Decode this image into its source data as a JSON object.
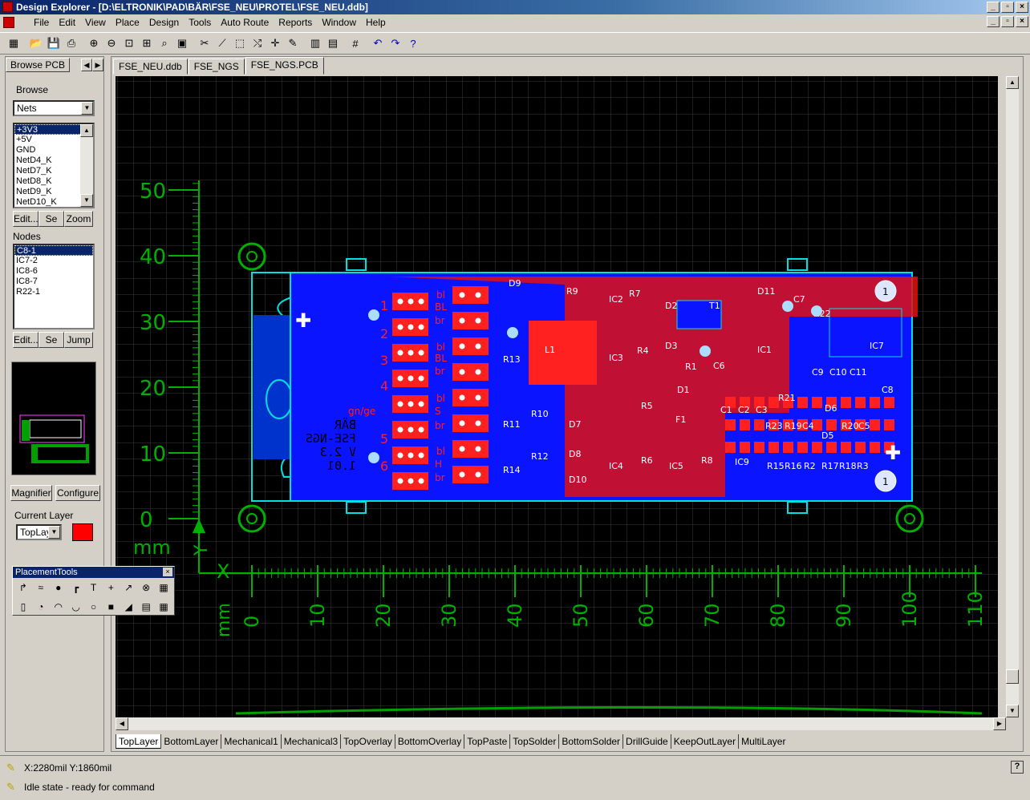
{
  "window": {
    "title": "Design Explorer - [D:\\ELTRONIK\\PAD\\BÄR\\FSE_NEU\\PROTEL\\FSE_NEU.ddb]"
  },
  "menu": [
    "File",
    "Edit",
    "View",
    "Place",
    "Design",
    "Tools",
    "Auto Route",
    "Reports",
    "Window",
    "Help"
  ],
  "toolbar_icons": [
    "design-manager-icon",
    "open-icon",
    "save-icon",
    "print-icon",
    "zoom-in-icon",
    "zoom-out-icon",
    "zoom-fit-icon",
    "zoom-area-icon",
    "zoom-selected-icon",
    "browse-icon",
    "cut-icon",
    "paste-icon",
    "select-icon",
    "deselect-icon",
    "move-icon",
    "cross-probe-icon",
    "library-icon",
    "component-icon",
    "grid-icon",
    "undo-icon",
    "redo-icon",
    "help-icon"
  ],
  "left_panel": {
    "tab": "Browse PCB",
    "browse_label": "Browse",
    "browse_select": "Nets",
    "nets": [
      "+3V3",
      "+5V",
      "GND",
      "NetD4_K",
      "NetD7_K",
      "NetD8_K",
      "NetD9_K",
      "NetD10_K"
    ],
    "net_buttons": [
      "Edit...",
      "Se",
      "Zoom"
    ],
    "nodes_label": "Nodes",
    "nodes": [
      "C8-1",
      "IC7-2",
      "IC8-6",
      "IC8-7",
      "R22-1"
    ],
    "node_buttons": [
      "Edit...",
      "Se",
      "Jump"
    ],
    "magnifier": "Magnifier",
    "configure": "Configure",
    "current_layer_label": "Current Layer",
    "current_layer": "TopLay",
    "current_layer_color": "#ff0000"
  },
  "doc_tabs": [
    "FSE_NEU.ddb",
    "FSE_NGS",
    "FSE_NGS.PCB"
  ],
  "layer_tabs": [
    "TopLayer",
    "BottomLayer",
    "Mechanical1",
    "Mechanical3",
    "TopOverlay",
    "BottomOverlay",
    "TopPaste",
    "TopSolder",
    "BottomSolder",
    "DrillGuide",
    "KeepOutLayer",
    "MultiLayer"
  ],
  "ruler": {
    "y_labels": [
      "50",
      "40",
      "30",
      "20",
      "10",
      "0"
    ],
    "x_labels": [
      "0",
      "10",
      "20",
      "30",
      "40",
      "50",
      "60",
      "70",
      "80",
      "90",
      "100",
      "110"
    ],
    "unit": "mm",
    "x_axis": "X",
    "y_axis": "Y"
  },
  "pcb": {
    "labels": [
      "D9",
      "R9",
      "IC2",
      "R7",
      "D2",
      "T1",
      "D11",
      "C7",
      "R22",
      "IC7",
      "L1",
      "D3",
      "R4",
      "IC1",
      "R13",
      "IC3",
      "R1",
      "C6",
      "C9",
      "C10",
      "C11",
      "C8",
      "D1",
      "R21",
      "R10",
      "R5",
      "F1",
      "C1",
      "C2",
      "C3",
      "D6",
      "R11",
      "D7",
      "R23",
      "R19",
      "C4",
      "R20",
      "C5",
      "D5",
      "R12",
      "D8",
      "IC4",
      "R6",
      "R8",
      "IC9",
      "R15",
      "R16",
      "R2",
      "R17",
      "R18",
      "R3",
      "R14",
      "D10",
      "IC5"
    ],
    "wire_labels": [
      "bl",
      "BL",
      "br",
      "bl",
      "BL",
      "br",
      "bl",
      "gn/ge",
      "S",
      "br",
      "bl",
      "H",
      "br"
    ],
    "numbers": [
      "1",
      "2",
      "3",
      "4",
      "5",
      "6"
    ],
    "bottom_text": [
      "BÄR",
      "FSE-NGS",
      "V 2.3",
      "1.01"
    ],
    "mount_numbers": [
      "1",
      "1"
    ]
  },
  "placement_tools": {
    "title": "PlacementTools"
  },
  "status": {
    "coords": "X:2280mil Y:1860mil",
    "state": "Idle state - ready for command",
    "help": "?"
  }
}
